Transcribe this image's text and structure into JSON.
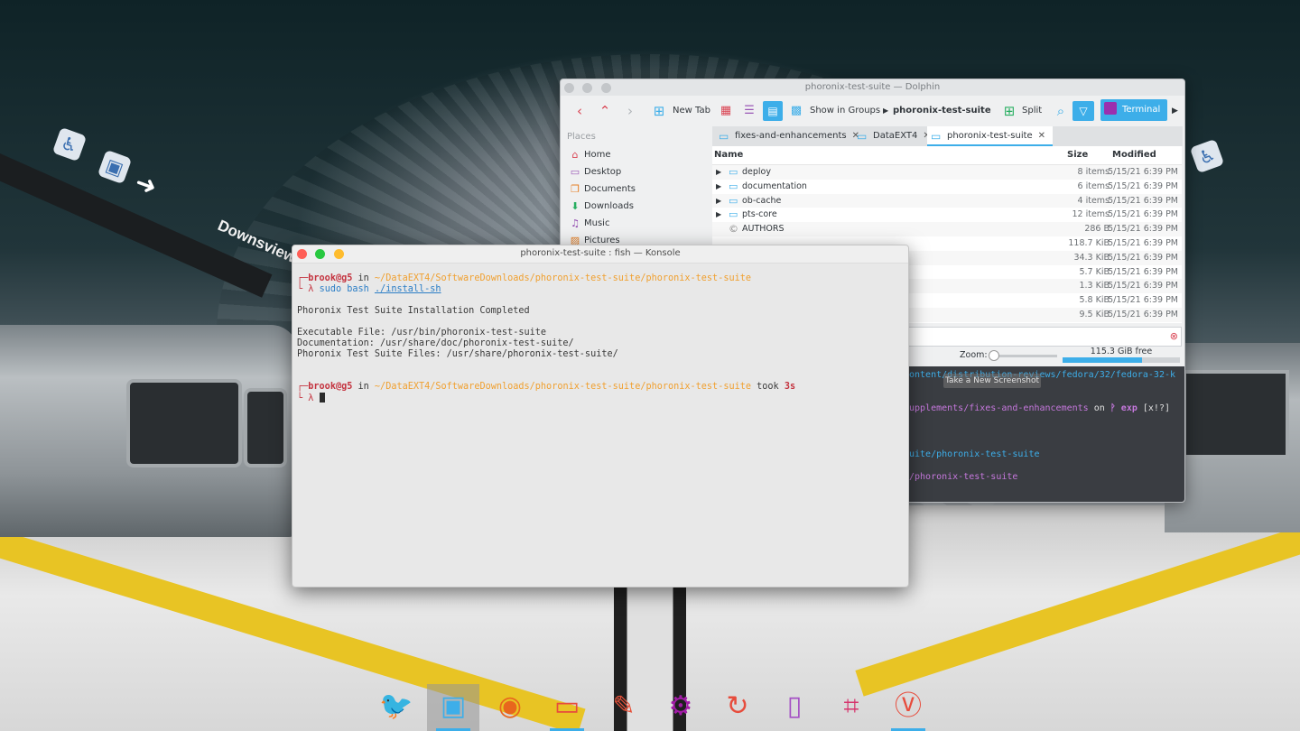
{
  "wallpaper": {
    "station_sign": "Downsview"
  },
  "dolphin": {
    "title": "phoronix-test-suite — Dolphin",
    "toolbar": {
      "new_tab": "New Tab",
      "show_in_groups": "Show in Groups",
      "breadcrumb": "phoronix-test-suite",
      "split": "Split",
      "terminal": "Terminal"
    },
    "places": {
      "header": "Places",
      "items": [
        {
          "label": "Home",
          "icon": "home-icon",
          "color": "#da4453"
        },
        {
          "label": "Desktop",
          "icon": "desktop-icon",
          "color": "#9b59b6"
        },
        {
          "label": "Documents",
          "icon": "documents-icon",
          "color": "#e67e22"
        },
        {
          "label": "Downloads",
          "icon": "downloads-icon",
          "color": "#27ae60"
        },
        {
          "label": "Music",
          "icon": "music-icon",
          "color": "#8e44ad"
        },
        {
          "label": "Pictures",
          "icon": "pictures-icon",
          "color": "#e67e22"
        }
      ]
    },
    "tabs": [
      {
        "label": "fixes-and-enhancements"
      },
      {
        "label": "DataEXT4"
      },
      {
        "label": "phoronix-test-suite"
      }
    ],
    "columns": {
      "name": "Name",
      "size": "Size",
      "modified": "Modified"
    },
    "files": [
      {
        "name": "deploy",
        "size": "8 items",
        "modified": "5/15/21 6:39 PM"
      },
      {
        "name": "documentation",
        "size": "6 items",
        "modified": "5/15/21 6:39 PM"
      },
      {
        "name": "ob-cache",
        "size": "4 items",
        "modified": "5/15/21 6:39 PM"
      },
      {
        "name": "pts-core",
        "size": "12 items",
        "modified": "5/15/21 6:39 PM"
      },
      {
        "name": "AUTHORS",
        "size": "286 B",
        "modified": "5/15/21 6:39 PM"
      },
      {
        "name": "",
        "size": "118.7 KiB",
        "modified": "5/15/21 6:39 PM"
      },
      {
        "name": "",
        "size": "34.3 KiB",
        "modified": "5/15/21 6:39 PM"
      },
      {
        "name": "",
        "size": "5.7 KiB",
        "modified": "5/15/21 6:39 PM"
      },
      {
        "name": "",
        "size": "1.3 KiB",
        "modified": "5/15/21 6:39 PM"
      },
      {
        "name": "",
        "size": "5.8 KiB",
        "modified": "5/15/21 6:39 PM"
      },
      {
        "name": "",
        "size": "9.5 KiB",
        "modified": "5/15/21 6:39 PM"
      }
    ],
    "status": {
      "zoom_label": "Zoom:",
      "free_space": "115.3 GiB free",
      "free_fraction": 0.68
    },
    "embedded_terminal": {
      "line1": "ontent/distribution-reviews/fedora/32/fedora-32-k",
      "line2a": "upplements/fixes-and-enhancements",
      "line2b": " on ",
      "line2c": "ᚹ exp",
      "line2d": " [x!?]",
      "line3": "uite/phoronix-test-suite",
      "line4": "/phoronix-test-suite"
    },
    "tooltip": "Take a New Screenshot"
  },
  "konsole": {
    "title": "phoronix-test-suite : fish — Konsole",
    "prompt1": {
      "user": "brook",
      "at": "@",
      "host": "g5",
      "in": " in ",
      "path": "~/DataEXT4/SoftwareDownloads/phoronix-test-suite/phoronix-test-suite"
    },
    "command": {
      "sudo": "sudo",
      "bash": "bash",
      "arg": "./install-sh"
    },
    "output": [
      "Phoronix Test Suite Installation Completed",
      "",
      "Executable File: /usr/bin/phoronix-test-suite",
      "Documentation: /usr/share/doc/phoronix-test-suite/",
      "Phoronix Test Suite Files: /usr/share/phoronix-test-suite/"
    ],
    "prompt2": {
      "user": "brook",
      "at": "@",
      "host": "g5",
      "in": " in ",
      "path": "~/DataEXT4/SoftwareDownloads/phoronix-test-suite/phoronix-test-suite",
      "took": " took ",
      "duration": "3s"
    },
    "lambda": "λ"
  },
  "dock": {
    "items": [
      {
        "icon": "bird-icon",
        "color": "#d32f2f"
      },
      {
        "icon": "terminal-icon",
        "color": "#3daee9",
        "active": true
      },
      {
        "icon": "firefox-icon",
        "color": "#e8661d"
      },
      {
        "icon": "folder-icon",
        "color": "#e74c3c"
      },
      {
        "icon": "text-editor-icon",
        "color": "#e55039"
      },
      {
        "icon": "settings-icon",
        "color": "#a21ca7"
      },
      {
        "icon": "refresh-app-icon",
        "color": "#e74c3c"
      },
      {
        "icon": "phone-icon",
        "color": "#a44fc4"
      },
      {
        "icon": "crop-icon",
        "color": "#d6336c"
      },
      {
        "icon": "vivaldi-icon",
        "color": "#e74c3c"
      }
    ]
  }
}
